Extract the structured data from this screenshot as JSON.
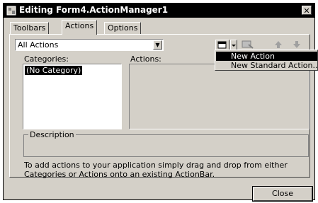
{
  "window": {
    "title": "Editing Form4.ActionManager1",
    "close_glyph": "✕"
  },
  "tabs": [
    {
      "label": "Toolbars"
    },
    {
      "label": "Actions"
    },
    {
      "label": "Options"
    }
  ],
  "filter": {
    "value": "All Actions"
  },
  "categories": {
    "label": "Categories:",
    "items": [
      "(No Category)"
    ]
  },
  "actions": {
    "label": "Actions:"
  },
  "description": {
    "legend": "Description",
    "hint": "To add actions to your application simply drag and drop from either Categories or Actions onto an existing ActionBar."
  },
  "buttons": {
    "close": "Close"
  },
  "context_menu": {
    "items": [
      "New Action",
      "New Standard Action..."
    ]
  },
  "icons": [
    "app-icon",
    "new-action-icon",
    "dropdown-arrow-icon",
    "delete-icon",
    "move-up-icon",
    "move-down-icon"
  ]
}
